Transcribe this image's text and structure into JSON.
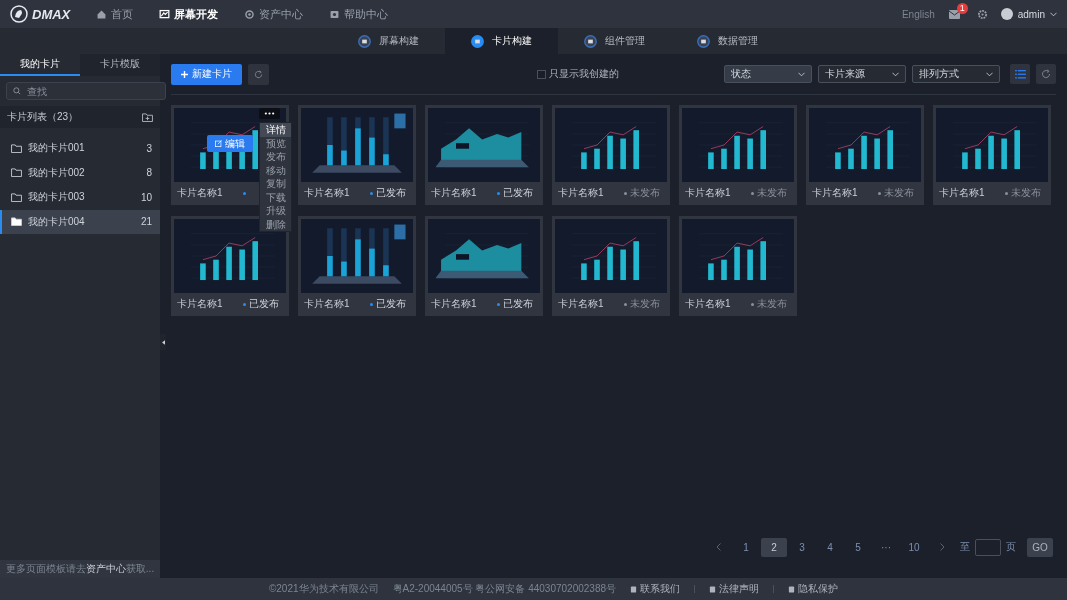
{
  "topbar": {
    "logo": "DMAX",
    "nav": [
      {
        "label": "首页",
        "selected": false
      },
      {
        "label": "屏幕开发",
        "selected": true
      },
      {
        "label": "资产中心",
        "selected": false
      },
      {
        "label": "帮助中心",
        "selected": false
      }
    ],
    "language": "English",
    "mail_badge": "1",
    "user": "admin"
  },
  "subtabs": [
    {
      "label": "屏幕构建",
      "selected": false
    },
    {
      "label": "卡片构建",
      "selected": true
    },
    {
      "label": "组件管理",
      "selected": false
    },
    {
      "label": "数据管理",
      "selected": false
    }
  ],
  "sidebar": {
    "tabs": [
      {
        "label": "我的卡片",
        "selected": true
      },
      {
        "label": "卡片模版",
        "selected": false
      }
    ],
    "search": {
      "placeholder": "查找"
    },
    "list_title": "卡片列表（23）",
    "folders": [
      {
        "name": "我的卡片001",
        "count": "3",
        "selected": false
      },
      {
        "name": "我的卡片002",
        "count": "8",
        "selected": false
      },
      {
        "name": "我的卡片003",
        "count": "10",
        "selected": false
      },
      {
        "name": "我的卡片004",
        "count": "21",
        "selected": true
      }
    ],
    "hint": "更多页面模板请去**资产中心**获取..."
  },
  "toolbar": {
    "new_button": "新建卡片",
    "only_mine": {
      "label": "只显示我创建的",
      "checked": false
    },
    "selects": [
      "状态",
      "卡片来源",
      "排列方式"
    ]
  },
  "cards": [
    {
      "name": "卡片名称1",
      "kind": "bar",
      "published": true
    },
    {
      "name": "卡片名称1",
      "kind": "bar3d",
      "published": true,
      "status": "已发布"
    },
    {
      "name": "卡片名称1",
      "kind": "area",
      "published": true,
      "status": "已发布"
    },
    {
      "name": "卡片名称1",
      "kind": "bar",
      "published": false,
      "status": "未发布"
    },
    {
      "name": "卡片名称1",
      "kind": "bar",
      "published": false,
      "status": "未发布"
    },
    {
      "name": "卡片名称1",
      "kind": "bar",
      "published": false,
      "status": "未发布"
    },
    {
      "name": "卡片名称1",
      "kind": "bar",
      "published": false,
      "status": "未发布"
    },
    {
      "name": "卡片名称1",
      "kind": "bar",
      "published": true,
      "status": "已发布"
    },
    {
      "name": "卡片名称1",
      "kind": "bar3d",
      "published": true,
      "status": "已发布"
    },
    {
      "name": "卡片名称1",
      "kind": "area",
      "published": true,
      "status": "已发布"
    },
    {
      "name": "卡片名称1",
      "kind": "bar",
      "published": false,
      "status": "未发布"
    },
    {
      "name": "卡片名称1",
      "kind": "bar",
      "published": false,
      "status": "未发布"
    }
  ],
  "card_menu": {
    "edit_button": "编辑",
    "items": [
      {
        "label": "详情",
        "selected": true
      },
      {
        "label": "预览",
        "selected": false
      },
      {
        "label": "发布",
        "selected": false
      },
      {
        "label": "移动",
        "selected": false
      },
      {
        "label": "复制",
        "selected": false
      },
      {
        "label": "下载",
        "selected": false
      },
      {
        "label": "升级",
        "selected": false
      },
      {
        "label": "删除",
        "selected": false
      }
    ]
  },
  "pagination": {
    "pages": [
      {
        "label": "1",
        "selected": false
      },
      {
        "label": "2",
        "selected": true
      },
      {
        "label": "3",
        "selected": false
      },
      {
        "label": "4",
        "selected": false
      },
      {
        "label": "5",
        "selected": false
      },
      {
        "label": "···",
        "selected": false
      },
      {
        "label": "10",
        "selected": false
      }
    ],
    "goto_prefix": "至",
    "goto_suffix": "页",
    "go_button": "GO"
  },
  "footer": {
    "copyright": "©2021华为技术有限公司",
    "license": "粤A2-20044005号 粤公网安备 44030702002388号",
    "links": [
      "联系我们",
      "法律声明",
      "隐私保护"
    ]
  }
}
